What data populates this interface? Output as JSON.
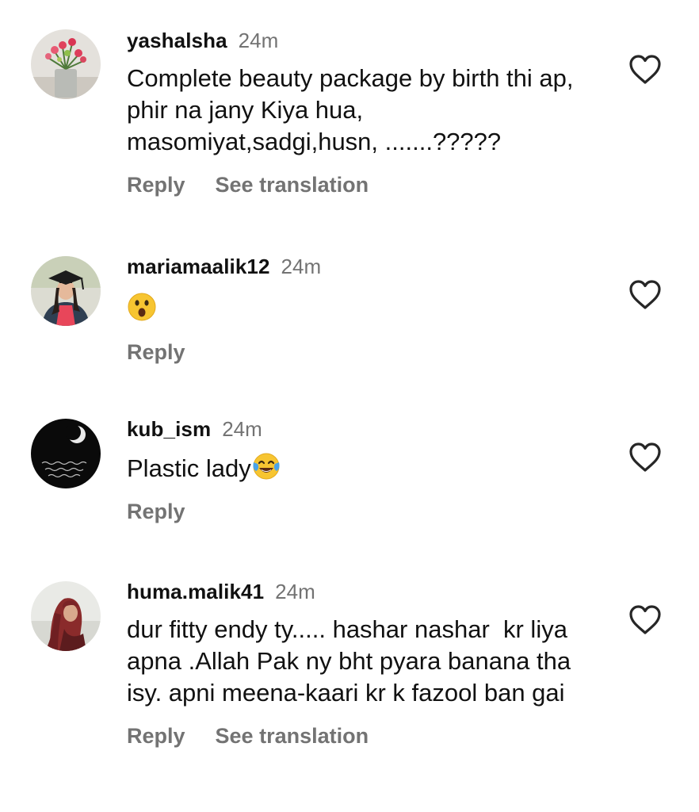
{
  "comments": [
    {
      "username": "yashalsha",
      "time": "24m",
      "text": "Complete beauty package by birth thi ap, phir na jany Kiya hua, masomiyat,sadgi,husn, .......?????",
      "reply_label": "Reply",
      "translation_label": "See translation",
      "avatar_icon": "flower-vase-photo",
      "like_icon": "heart-outline-icon"
    },
    {
      "username": "mariamaalik12",
      "time": "24m",
      "text_emoji": "astonished-face-emoji",
      "reply_label": "Reply",
      "avatar_icon": "graduate-girl-photo",
      "like_icon": "heart-outline-icon"
    },
    {
      "username": "kub_ism",
      "time": "24m",
      "text": "Plastic lady",
      "text_emoji": "face-with-tears-of-joy-emoji",
      "reply_label": "Reply",
      "avatar_icon": "crescent-moon-poetry-photo",
      "like_icon": "heart-outline-icon"
    },
    {
      "username": "huma.malik41",
      "time": "24m",
      "text": "dur fitty endy ty..... hashar nashar  kr liya apna .Allah Pak ny bht pyara banana tha isy. apni meena-kaari kr k fazool ban gai",
      "reply_label": "Reply",
      "translation_label": "See translation",
      "avatar_icon": "red-hair-woman-photo",
      "like_icon": "heart-outline-icon"
    }
  ],
  "colors": {
    "text": "#111111",
    "secondary": "#737373",
    "background": "#ffffff"
  }
}
